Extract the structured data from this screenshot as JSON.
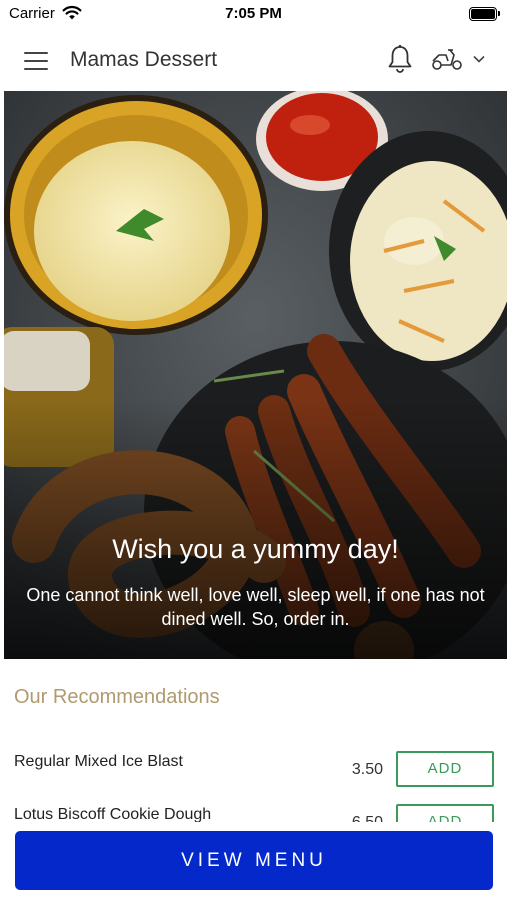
{
  "status_bar": {
    "carrier": "Carrier",
    "time": "7:05 PM",
    "icons": [
      "wifi-icon",
      "battery-icon"
    ]
  },
  "header": {
    "title": "Mamas Dessert",
    "icons": [
      "menu-icon",
      "bell-icon",
      "scooter-icon",
      "chevron-down-icon"
    ]
  },
  "hero": {
    "title": "Wish you a yummy day!",
    "subtitle": "One cannot think well, love well, sleep well, if one has not dined well. So, order in."
  },
  "recommendations": {
    "title": "Our Recommendations",
    "items": [
      {
        "name": "Regular Mixed Ice Blast",
        "price": "3.50",
        "action": "ADD"
      },
      {
        "name": "Lotus Biscoff Cookie Dough",
        "price": "6.50",
        "action": "ADD"
      }
    ]
  },
  "footer": {
    "view_menu_label": "VIEW MENU"
  },
  "colors": {
    "accent_blue": "#0428c9",
    "add_green": "#3a9a5a",
    "section_title": "#b09a6f"
  }
}
